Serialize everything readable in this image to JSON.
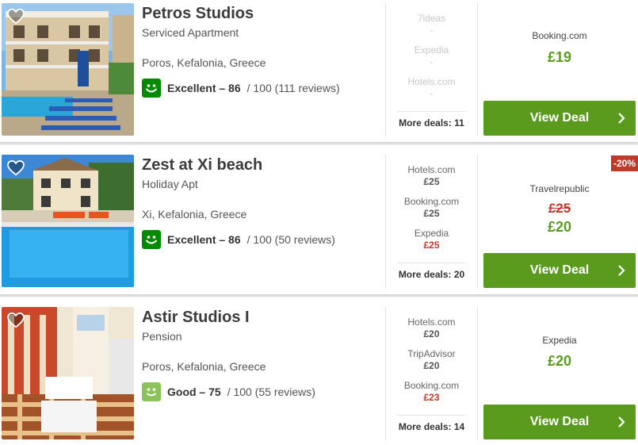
{
  "hotels": [
    {
      "name": "Petros Studios",
      "type": "Serviced Apartment",
      "location": "Poros, Kefalonia, Greece",
      "rating_label": "Excellent – 86",
      "rating_rest": "/ 100 (111 reviews)",
      "smiley_color": "#008a00",
      "deals": [
        {
          "site": "7ideas",
          "price": "-"
        },
        {
          "site": "Expedia",
          "price": "-"
        },
        {
          "site": "Hotels.com",
          "price": "-"
        }
      ],
      "more_deals": "More deals: 11",
      "best_site": "Booking.com",
      "best_price": "£19",
      "old_price": "",
      "button": "View Deal"
    },
    {
      "name": "Zest at Xi beach",
      "type": "Holiday Apt",
      "location": "Xi, Kefalonia, Greece",
      "rating_label": "Excellent – 86",
      "rating_rest": "/ 100 (50 reviews)",
      "smiley_color": "#008a00",
      "deals": [
        {
          "site": "Hotels.com",
          "price": "£25"
        },
        {
          "site": "Booking.com",
          "price": "£25"
        },
        {
          "site": "Expedia",
          "price": "£25"
        }
      ],
      "more_deals": "More deals: 20",
      "best_site": "Travelrepublic",
      "old_price": "£25",
      "best_price": "£20",
      "discount": "-20%",
      "button": "View Deal"
    },
    {
      "name": "Astir Studios I",
      "type": "Pension",
      "location": "Poros, Kefalonia, Greece",
      "rating_label": "Good – 75",
      "rating_rest": "/ 100 (55 reviews)",
      "smiley_color": "#8cc25a",
      "deals": [
        {
          "site": "Hotels.com",
          "price": "£20"
        },
        {
          "site": "TripAdvisor",
          "price": "£20"
        },
        {
          "site": "Booking.com",
          "price": "£23"
        }
      ],
      "more_deals": "More deals: 14",
      "best_site": "Expedia",
      "best_price": "£20",
      "old_price": "",
      "button": "View Deal"
    }
  ]
}
